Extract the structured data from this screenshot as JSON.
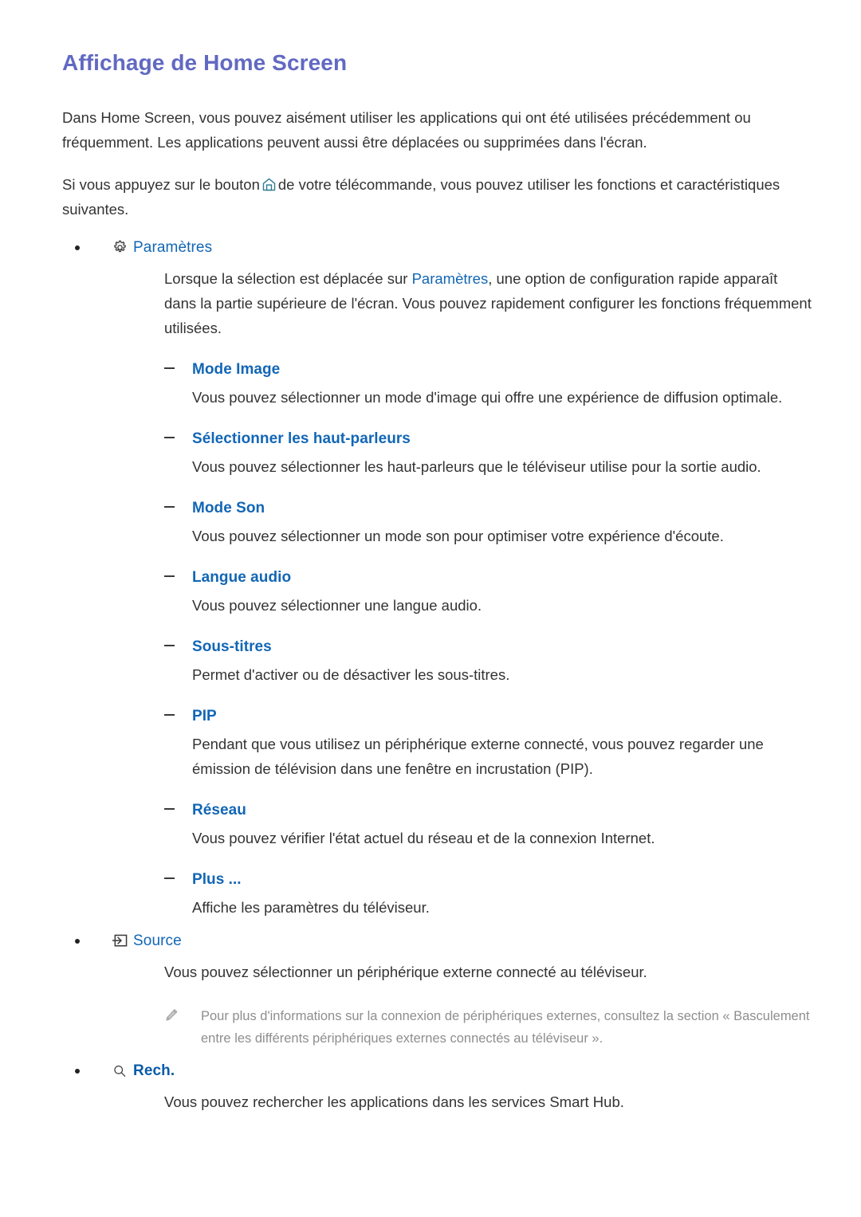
{
  "page": {
    "title": "Affichage de Home Screen"
  },
  "intro": {
    "paragraph1": "Dans Home Screen, vous pouvez aisément utiliser les applications qui ont été utilisées précédemment ou fréquemment. Les applications peuvent aussi être déplacées ou supprimées dans l'écran.",
    "paragraph2_before": "Si vous appuyez sur le bouton",
    "paragraph2_after": "de votre télécommande, vous pouvez utiliser les fonctions et caractéristiques suivantes.",
    "home_icon": "home-icon"
  },
  "settings_section": {
    "icon": "gear-icon",
    "label": "Paramètres",
    "description_part1": "Lorsque la sélection est déplacée sur ",
    "description_link": "Paramètres",
    "description_part2": ", une option de configuration rapide apparaît dans la partie supérieure de l'écran. Vous pouvez rapidement configurer les fonctions fréquemment utilisées.",
    "items": [
      {
        "label": "Mode Image",
        "description": "Vous pouvez sélectionner un mode d'image qui offre une expérience de diffusion optimale."
      },
      {
        "label": "Sélectionner les haut-parleurs",
        "description": "Vous pouvez sélectionner les haut-parleurs que le téléviseur utilise pour la sortie audio."
      },
      {
        "label": "Mode Son",
        "description": "Vous pouvez sélectionner un mode son pour optimiser votre expérience d'écoute."
      },
      {
        "label": "Langue audio",
        "description": "Vous pouvez sélectionner une langue audio."
      },
      {
        "label": "Sous-titres",
        "description": "Permet d'activer ou de désactiver les sous-titres."
      },
      {
        "label": "PIP",
        "description": "Pendant que vous utilisez un périphérique externe connecté, vous pouvez regarder une émission de télévision dans une fenêtre en incrustation (PIP)."
      },
      {
        "label": "Réseau",
        "description": "Vous pouvez vérifier l'état actuel du réseau et de la connexion Internet."
      },
      {
        "label": "Plus ...",
        "description": "Affiche les paramètres du téléviseur."
      }
    ]
  },
  "source_section": {
    "icon": "source-input-icon",
    "label": "Source",
    "description": "Vous pouvez sélectionner un périphérique externe connecté au téléviseur.",
    "note_icon": "pencil-icon",
    "note": "Pour plus d'informations sur la connexion de périphériques externes, consultez la section « Basculement entre les différents périphériques externes connectés au téléviseur »."
  },
  "search_section": {
    "icon": "search-icon",
    "label": "Rech.",
    "description": "Vous pouvez rechercher les applications dans les services Smart Hub."
  },
  "colors": {
    "title": "#6169c2",
    "link": "#1266b5",
    "body_text": "#333333",
    "note_text": "#8e8e8e",
    "home_icon": "#2f7d92"
  }
}
